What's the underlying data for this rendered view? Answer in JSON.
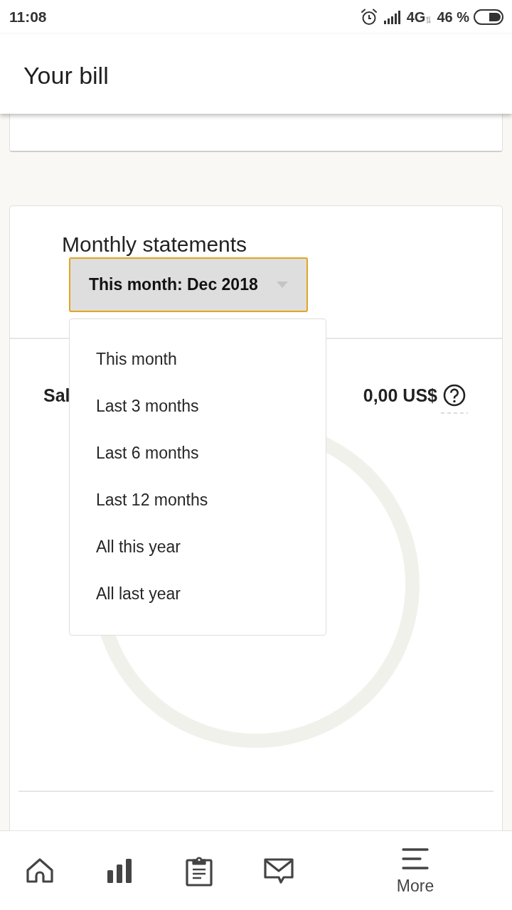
{
  "status_bar": {
    "time": "11:08",
    "network": "4G",
    "battery": "46 %"
  },
  "app_bar": {
    "title": "Your bill"
  },
  "statements": {
    "title": "Monthly statements",
    "period_select": {
      "value": "This month: Dec 2018",
      "expanded": true
    },
    "period_options": [
      {
        "label": "This month",
        "selected": false
      },
      {
        "label": "Last 3 months",
        "selected": false
      },
      {
        "label": "Last 6 months",
        "selected": false
      },
      {
        "label": "Last 12 months",
        "selected": false
      },
      {
        "label": "All this year",
        "selected": false
      },
      {
        "label": "All last year",
        "selected": false
      }
    ]
  },
  "balance": {
    "label": "Sal",
    "amount": "0,00 US$"
  },
  "bottom_nav": {
    "more_label": "More"
  }
}
